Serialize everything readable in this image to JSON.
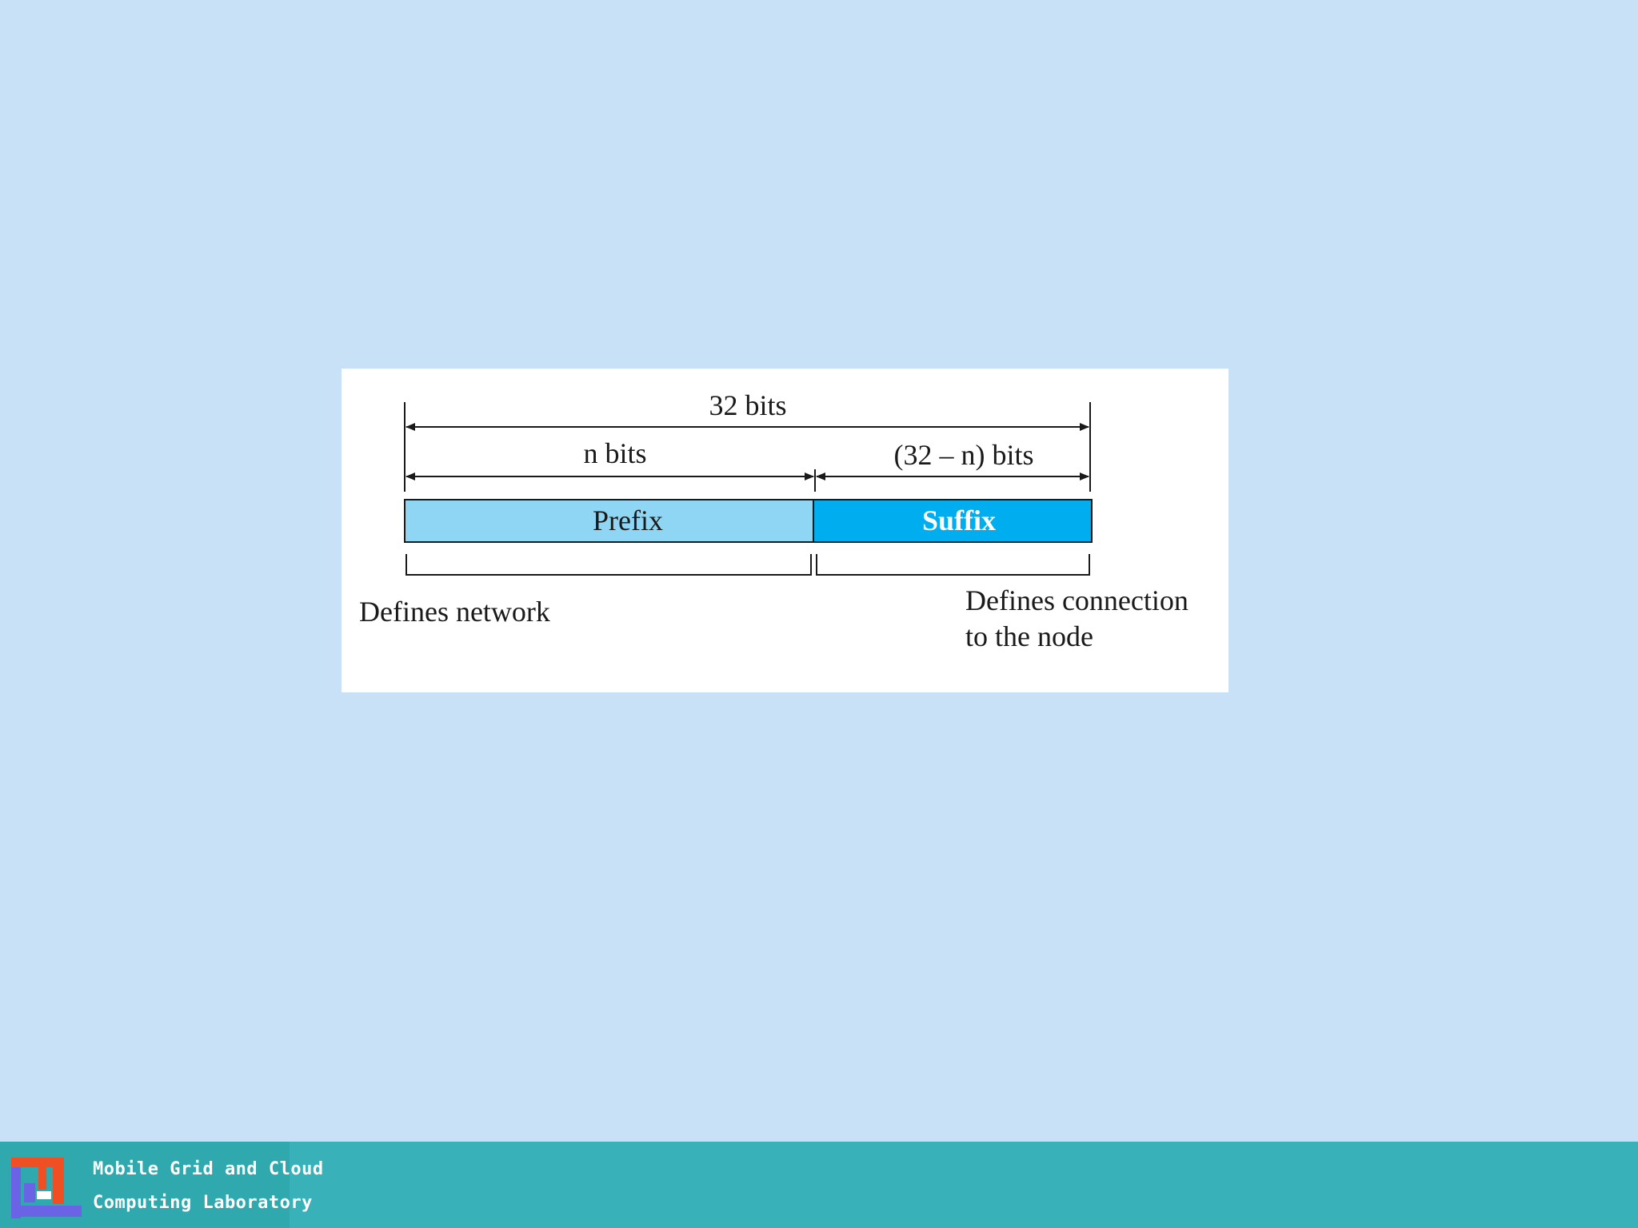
{
  "diagram": {
    "total_label": "32 bits",
    "prefix_width_label": "n bits",
    "suffix_width_label": "(32 – n) bits",
    "prefix_label": "Prefix",
    "suffix_label": "Suffix",
    "prefix_description": "Defines network",
    "suffix_description_line1": "Defines connection",
    "suffix_description_line2": "to the node",
    "colors": {
      "prefix_fill": "#8fd6f5",
      "suffix_fill": "#00aeef",
      "suffix_text": "#ffffff",
      "prefix_text": "#1a1a1a"
    }
  },
  "footer": {
    "line1": "Mobile Grid and Cloud",
    "line2": "Computing Laboratory",
    "logo_icon": "lab-logo-icon",
    "colors": {
      "bar": "#38b2b8",
      "logo_block": "#2fa9ad"
    }
  },
  "background_color": "#c8e1f7"
}
